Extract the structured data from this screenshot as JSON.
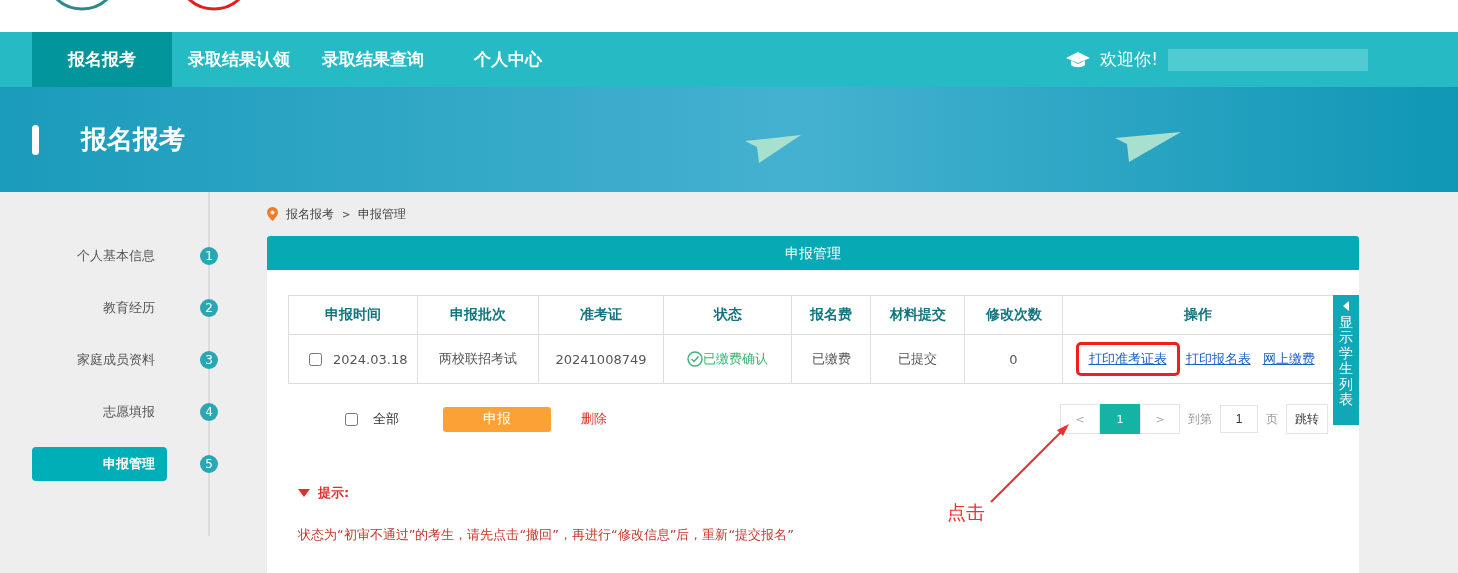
{
  "nav": {
    "items": [
      {
        "label": "报名报考",
        "selected": true
      },
      {
        "label": "录取结果认领",
        "selected": false
      },
      {
        "label": "录取结果查询",
        "selected": false
      },
      {
        "label": "个人中心",
        "selected": false
      }
    ],
    "welcome": "欢迎你!"
  },
  "banner": {
    "title": "报名报考"
  },
  "sidebar": {
    "steps": [
      {
        "label": "个人基本信息",
        "number": "1",
        "selected": false
      },
      {
        "label": "教育经历",
        "number": "2",
        "selected": false
      },
      {
        "label": "家庭成员资料",
        "number": "3",
        "selected": false
      },
      {
        "label": "志愿填报",
        "number": "4",
        "selected": false
      },
      {
        "label": "申报管理",
        "number": "5",
        "selected": true
      }
    ]
  },
  "breadcrumb": {
    "items": [
      "报名报考",
      "申报管理"
    ],
    "separator": ">"
  },
  "panel": {
    "title": "申报管理",
    "table": {
      "columns": [
        "申报时间",
        "申报批次",
        "准考证",
        "状态",
        "报名费",
        "材料提交",
        "修改次数",
        "操作"
      ],
      "rows": [
        {
          "checked": false,
          "date": "2024.03.18",
          "batch": "两校联招考试",
          "ticket": "20241008749",
          "status": "已缴费确认",
          "fee": "已缴费",
          "materials": "已提交",
          "edits": "0",
          "actions": [
            {
              "label": "打印准考证表",
              "highlighted": true
            },
            {
              "label": "打印报名表",
              "highlighted": false
            },
            {
              "label": "网上缴费",
              "highlighted": false
            }
          ]
        }
      ]
    },
    "select_all": {
      "label": "全部",
      "checked": false
    },
    "submit": "申报",
    "delete": "删除",
    "pagination": {
      "prev": "<",
      "pages": [
        {
          "label": "1",
          "selected": true
        }
      ],
      "next": ">",
      "goto_label": "到第",
      "page_input": "1",
      "page_unit": "页",
      "jump": "跳转"
    },
    "side_tab": "显示学生列表",
    "annotation": "点击",
    "tip": {
      "title": "提示:",
      "text": "状态为“初审不通过”的考生，请先点击“撤回”，再进行“修改信息”后，重新“提交报名”"
    }
  }
}
